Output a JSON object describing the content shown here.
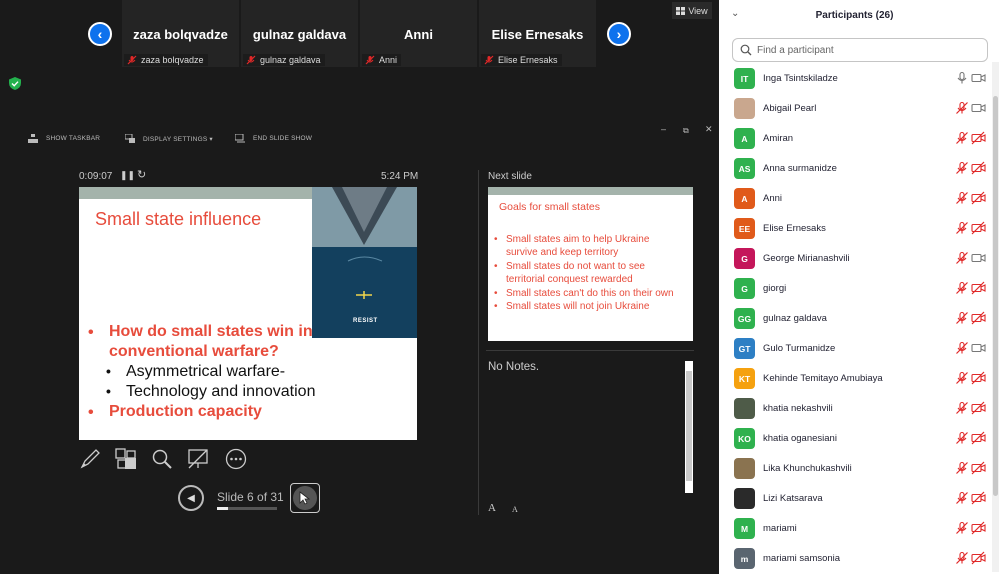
{
  "video_strip": {
    "tiles": [
      {
        "name": "zaza bolqvadze",
        "label": "zaza bolqvadze"
      },
      {
        "name": "gulnaz galdava",
        "label": "gulnaz galdava"
      },
      {
        "name": "Anni",
        "label": "Anni"
      },
      {
        "name": "Elise Ernesaks",
        "label": "Elise Ernesaks"
      }
    ],
    "view_label": "View"
  },
  "presenter": {
    "toolbar": {
      "show_taskbar": "SHOW TASKBAR",
      "display_settings": "DISPLAY SETTINGS ▾",
      "end_slide_show": "END SLIDE SHOW"
    },
    "timer": "0:09:07",
    "clock": "5:24 PM",
    "current_slide": {
      "title": "Small state influence",
      "image_caption": "RESIST",
      "bullets": [
        {
          "level": 1,
          "text": "How do small states win in"
        },
        {
          "level": 1,
          "text": "conventional warfare?"
        },
        {
          "level": 2,
          "text": "Asymmetrical warfare-"
        },
        {
          "level": 2,
          "text": "Technology and innovation"
        },
        {
          "level": 1,
          "text": "Production capacity"
        }
      ]
    },
    "slide_counter": "Slide 6 of 31",
    "slide_progress": 0.19,
    "next_slide_label": "Next slide",
    "next_slide": {
      "title": "Goals for small states",
      "bullets": [
        "Small states aim to help  Ukraine",
        "survive and keep territory",
        "Small states do not want to see",
        "territorial conquest rewarded",
        "Small states can't do this on their own",
        "Small states will not join Ukraine"
      ]
    },
    "notes": "No Notes.",
    "font_up": "A",
    "font_down": "A"
  },
  "participants": {
    "title": "Participants (26)",
    "search_placeholder": "Find a participant",
    "list": [
      {
        "initials": "IT",
        "name": "Inga Tsintskiladze",
        "color": "#2fb14e",
        "mic": "on",
        "video": "off"
      },
      {
        "initials": "",
        "name": "Abigail Pearl",
        "color": "#c9a78e",
        "mic": "muted",
        "video": "off"
      },
      {
        "initials": "A",
        "name": "Amiran",
        "color": "#2fb14e",
        "mic": "muted",
        "video": "off"
      },
      {
        "initials": "AS",
        "name": "Anna surmanidze",
        "color": "#2fb14e",
        "mic": "muted",
        "video": "off"
      },
      {
        "initials": "A",
        "name": "Anni",
        "color": "#e05a1a",
        "mic": "muted",
        "video": "off"
      },
      {
        "initials": "EE",
        "name": "Elise Ernesaks",
        "color": "#e05a1a",
        "mic": "muted",
        "video": "off"
      },
      {
        "initials": "G",
        "name": "George Mirianashvili",
        "color": "#c4165a",
        "mic": "muted",
        "video": "off"
      },
      {
        "initials": "G",
        "name": "giorgi",
        "color": "#2fb14e",
        "mic": "muted",
        "video": "off"
      },
      {
        "initials": "GG",
        "name": "gulnaz galdava",
        "color": "#2fb14e",
        "mic": "muted",
        "video": "off"
      },
      {
        "initials": "GT",
        "name": "Gulo Turmanidze",
        "color": "#2d7fc4",
        "mic": "muted",
        "video": "off"
      },
      {
        "initials": "KT",
        "name": "Kehinde Temitayo Amubiaya",
        "color": "#f5a10f",
        "mic": "muted",
        "video": "off"
      },
      {
        "initials": "",
        "name": "khatia nekashvili",
        "color": "#4e5b48",
        "mic": "muted",
        "video": "off"
      },
      {
        "initials": "KO",
        "name": "khatia oganesiani",
        "color": "#2fb14e",
        "mic": "muted",
        "video": "off"
      },
      {
        "initials": "",
        "name": "Lika Khunchukashvili",
        "color": "#8a7350",
        "mic": "muted",
        "video": "off"
      },
      {
        "initials": "",
        "name": "Lizi Katsarava",
        "color": "#2a2a2a",
        "mic": "muted",
        "video": "off"
      },
      {
        "initials": "M",
        "name": "mariami",
        "color": "#2fb14e",
        "mic": "muted",
        "video": "off"
      },
      {
        "initials": "m",
        "name": "mariami samsonia",
        "color": "#5a6570",
        "mic": "muted",
        "video": "off"
      }
    ]
  }
}
